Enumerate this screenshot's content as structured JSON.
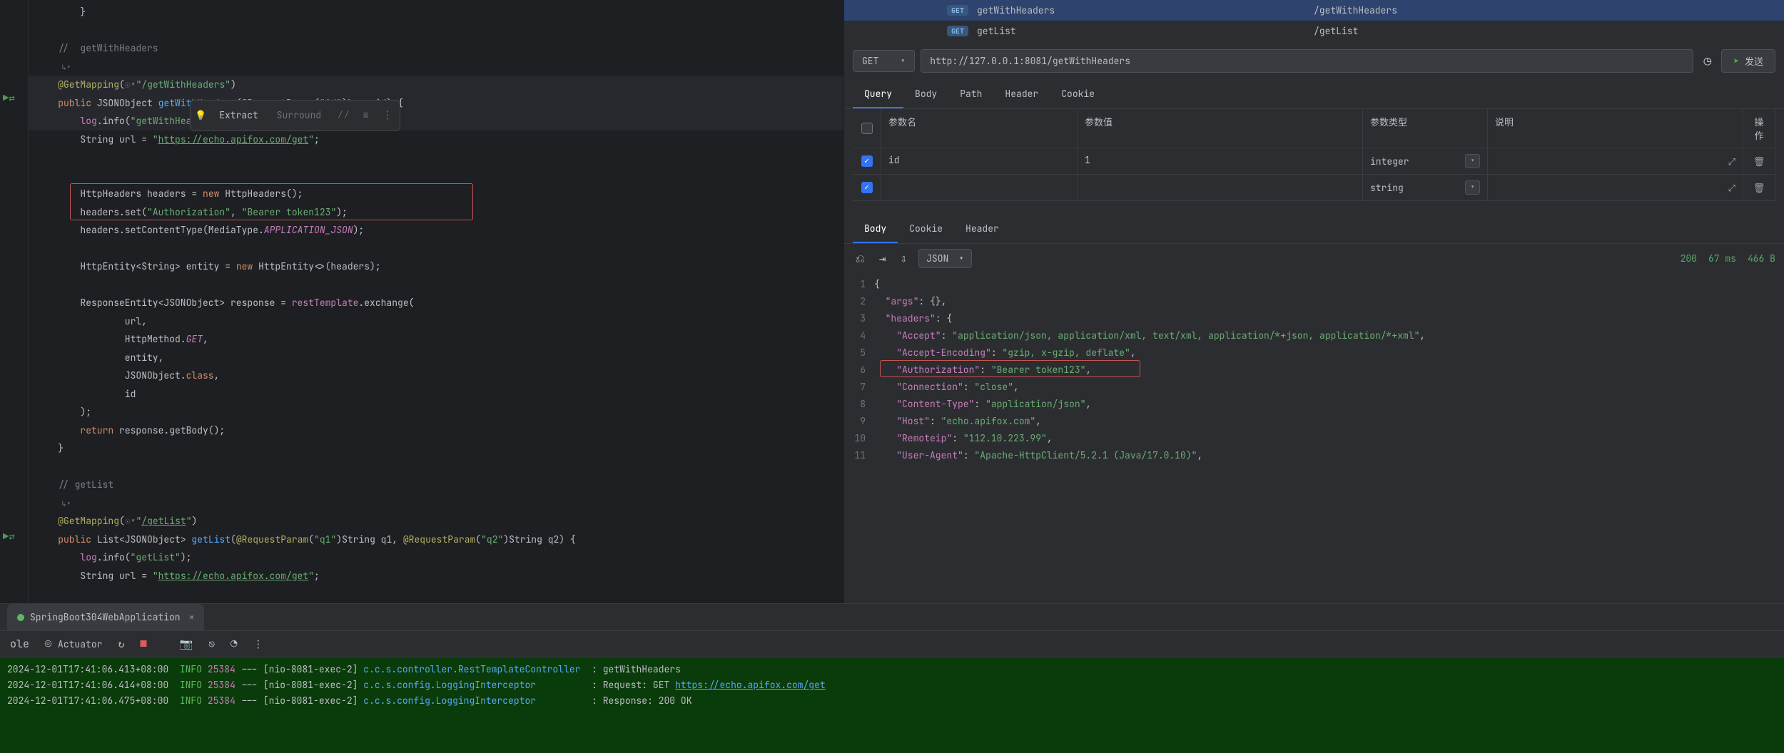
{
  "editor": {
    "popup": {
      "extract": "Extract",
      "surround": "Surround"
    },
    "lines": [
      {
        "t": "        }",
        "cls": ""
      },
      {
        "t": "",
        "cls": ""
      },
      {
        "t": "    //  getWithHeaders",
        "cls": "com"
      },
      {
        "t": "    ↳▾",
        "cls": "mini"
      },
      {
        "t": "GET_MAPPING_1",
        "cls": "hl special"
      },
      {
        "t": "GET_HEADERS_SIG",
        "cls": "hl special"
      },
      {
        "t": "LOG_GET_HEADERS",
        "cls": "hl special"
      },
      {
        "t": "URL_LINE_1",
        "cls": "special"
      },
      {
        "t": "",
        "cls": ""
      },
      {
        "t": "",
        "cls": ""
      },
      {
        "t": "HTTP_HEADERS_NEW",
        "cls": "special"
      },
      {
        "t": "HEADERS_SET_AUTH",
        "cls": "special"
      },
      {
        "t": "SET_CONTENT_TYPE",
        "cls": "special"
      },
      {
        "t": "",
        "cls": ""
      },
      {
        "t": "HTTP_ENTITY",
        "cls": "special"
      },
      {
        "t": "",
        "cls": ""
      },
      {
        "t": "RESP_EXCHANGE",
        "cls": "special"
      },
      {
        "t": "                url,",
        "cls": ""
      },
      {
        "t": "HTTP_METHOD_GET",
        "cls": "special"
      },
      {
        "t": "                entity,",
        "cls": ""
      },
      {
        "t": "JSON_OBJECT_CLASS",
        "cls": "special"
      },
      {
        "t": "                id",
        "cls": ""
      },
      {
        "t": "        );",
        "cls": ""
      },
      {
        "t": "RETURN_GETBODY",
        "cls": "special"
      },
      {
        "t": "    }",
        "cls": ""
      },
      {
        "t": "",
        "cls": ""
      },
      {
        "t": "    // getList",
        "cls": "com"
      },
      {
        "t": "    ↳▾",
        "cls": "mini"
      },
      {
        "t": "GET_MAPPING_2",
        "cls": "special"
      },
      {
        "t": "GET_LIST_SIG",
        "cls": "special"
      },
      {
        "t": "LOG_GET_LIST",
        "cls": "special"
      },
      {
        "t": "URL_LINE_2",
        "cls": "special"
      }
    ],
    "strings": {
      "getMapping1Path": "/getWithHeaders",
      "authHeader": "Authorization",
      "bearerToken": "Bearer token123",
      "echoUrl": "https://echo.apifox.com/get",
      "getMapping2Path": "/getList",
      "getWithHeadersKey": "getWithHeaders",
      "getListKey": "getList"
    }
  },
  "endpoints": [
    {
      "method": "GET",
      "name": "getWithHeaders",
      "path": "/getWithHeaders",
      "sel": true
    },
    {
      "method": "GET",
      "name": "getList",
      "path": "/getList",
      "sel": false
    }
  ],
  "request": {
    "method": "GET",
    "url": "http://127.0.0.1:8081/getWithHeaders",
    "sendLabel": "发送",
    "tabs": [
      "Query",
      "Body",
      "Path",
      "Header",
      "Cookie"
    ],
    "activeTab": "Query",
    "tableHeaders": {
      "name": "参数名",
      "value": "参数值",
      "type": "参数类型",
      "desc": "说明",
      "ops": "操作"
    },
    "params": [
      {
        "checked": true,
        "name": "id",
        "value": "1",
        "type": "integer"
      },
      {
        "checked": true,
        "name": "",
        "value": "",
        "type": "string"
      }
    ]
  },
  "response": {
    "tabs": [
      "Body",
      "Cookie",
      "Header"
    ],
    "activeTab": "Body",
    "format": "JSON",
    "status": "200",
    "time": "67 ms",
    "size": "466 B",
    "lines": [
      "{",
      "  \"args\": {},",
      "  \"headers\": {",
      "    \"Accept\": \"application/json, application/xml, text/xml, application/*+json, application/*+xml\",",
      "    \"Accept-Encoding\": \"gzip, x-gzip, deflate\",",
      "    \"Authorization\": \"Bearer token123\",",
      "    \"Connection\": \"close\",",
      "    \"Content-Type\": \"application/json\",",
      "    \"Host\": \"echo.apifox.com\",",
      "    \"Remoteip\": \"112.10.223.99\",",
      "    \"User-Agent\": \"Apache-HttpClient/5.2.1 (Java/17.0.10)\","
    ]
  },
  "run": {
    "tabName": "SpringBoot304WebApplication",
    "actuator": "Actuator",
    "logs": [
      {
        "ts": "2024-12-01T17:41:06.413+08:00",
        "level": "INFO",
        "pid": "25384",
        "thread": "[nio-8081-exec-2]",
        "logger": "c.c.s.controller.RestTemplateController",
        "msg": ": getWithHeaders"
      },
      {
        "ts": "2024-12-01T17:41:06.414+08:00",
        "level": "INFO",
        "pid": "25384",
        "thread": "[nio-8081-exec-2]",
        "logger": "c.c.s.config.LoggingInterceptor",
        "msg": ": Request: GET ",
        "link": "https://echo.apifox.com/get"
      },
      {
        "ts": "2024-12-01T17:41:06.475+08:00",
        "level": "INFO",
        "pid": "25384",
        "thread": "[nio-8081-exec-2]",
        "logger": "c.c.s.config.LoggingInterceptor",
        "msg": ": Response: 200 OK"
      }
    ]
  }
}
